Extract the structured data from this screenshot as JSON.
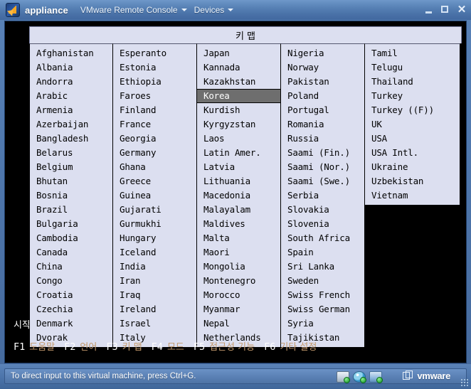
{
  "window": {
    "app_title": "appliance",
    "menus": [
      {
        "label": "VMware Remote Console",
        "icon": "chevron-down-icon"
      },
      {
        "label": "Devices",
        "icon": "chevron-down-icon"
      }
    ],
    "controls": {
      "minimize": "_",
      "maximize": "□",
      "close": "✕"
    }
  },
  "guest": {
    "background_text": "시작",
    "dialog": {
      "title": "키 맵",
      "selected_value": "Korea",
      "columns": [
        {
          "items": [
            "Afghanistan",
            "Albania",
            "Andorra",
            "Arabic",
            "Armenia",
            "Azerbaijan",
            "Bangladesh",
            "Belarus",
            "Belgium",
            "Bhutan",
            "Bosnia",
            "Brazil",
            "Bulgaria",
            "Cambodia",
            "Canada",
            "China",
            "Congo",
            "Croatia",
            "Czechia",
            "Denmark",
            "Dvorak"
          ]
        },
        {
          "items": [
            "Esperanto",
            "Estonia",
            "Ethiopia",
            "Faroes",
            "Finland",
            "France",
            "Georgia",
            "Germany",
            "Ghana",
            "Greece",
            "Guinea",
            "Gujarati",
            "Gurmukhi",
            "Hungary",
            "Iceland",
            "India",
            "Iran",
            "Iraq",
            "Ireland",
            "Israel",
            "Italy"
          ]
        },
        {
          "items": [
            "Japan",
            "Kannada",
            "Kazakhstan",
            "Korea",
            "Kurdish",
            "Kyrgyzstan",
            "Laos",
            "Latin Amer.",
            "Latvia",
            "Lithuania",
            "Macedonia",
            "Malayalam",
            "Maldives",
            "Malta",
            "Maori",
            "Mongolia",
            "Montenegro",
            "Morocco",
            "Myanmar",
            "Nepal",
            "Netherlands"
          ]
        },
        {
          "items": [
            "Nigeria",
            "Norway",
            "Pakistan",
            "Poland",
            "Portugal",
            "Romania",
            "Russia",
            "Saami (Fin.)",
            "Saami (Nor.)",
            "Saami (Swe.)",
            "Serbia",
            "Slovakia",
            "Slovenia",
            "South Africa",
            "Spain",
            "Sri Lanka",
            "Sweden",
            "Swiss French",
            "Swiss German",
            "Syria",
            "Tajikistan"
          ]
        },
        {
          "items": [
            "Tamil",
            "Telugu",
            "Thailand",
            "Turkey",
            "Turkey ((F))",
            "UK",
            "USA",
            "USA Intl.",
            "Ukraine",
            "Uzbekistan",
            "Vietnam"
          ]
        }
      ]
    },
    "function_keys": [
      {
        "key": "F1",
        "label": "도움말"
      },
      {
        "key": "F2",
        "label": "언어"
      },
      {
        "key": "F3",
        "label": "키 맵"
      },
      {
        "key": "F4",
        "label": "모드"
      },
      {
        "key": "F5",
        "label": "접근성 기능"
      },
      {
        "key": "F6",
        "label": "기타 설정"
      }
    ]
  },
  "statusbar": {
    "message": "To direct input to this virtual machine, press Ctrl+G.",
    "device_icons": [
      "hard-disk-icon",
      "cd-dvd-icon",
      "network-adapter-icon"
    ],
    "brand": "vmware"
  },
  "colors": {
    "title_bar": "#5781b5",
    "dialog_bg": "#dcdff0",
    "selection_bg": "#6e6e6e",
    "selection_fg": "#ffffff",
    "fkey_label": "#c49a6c",
    "guest_bg": "#000000"
  }
}
